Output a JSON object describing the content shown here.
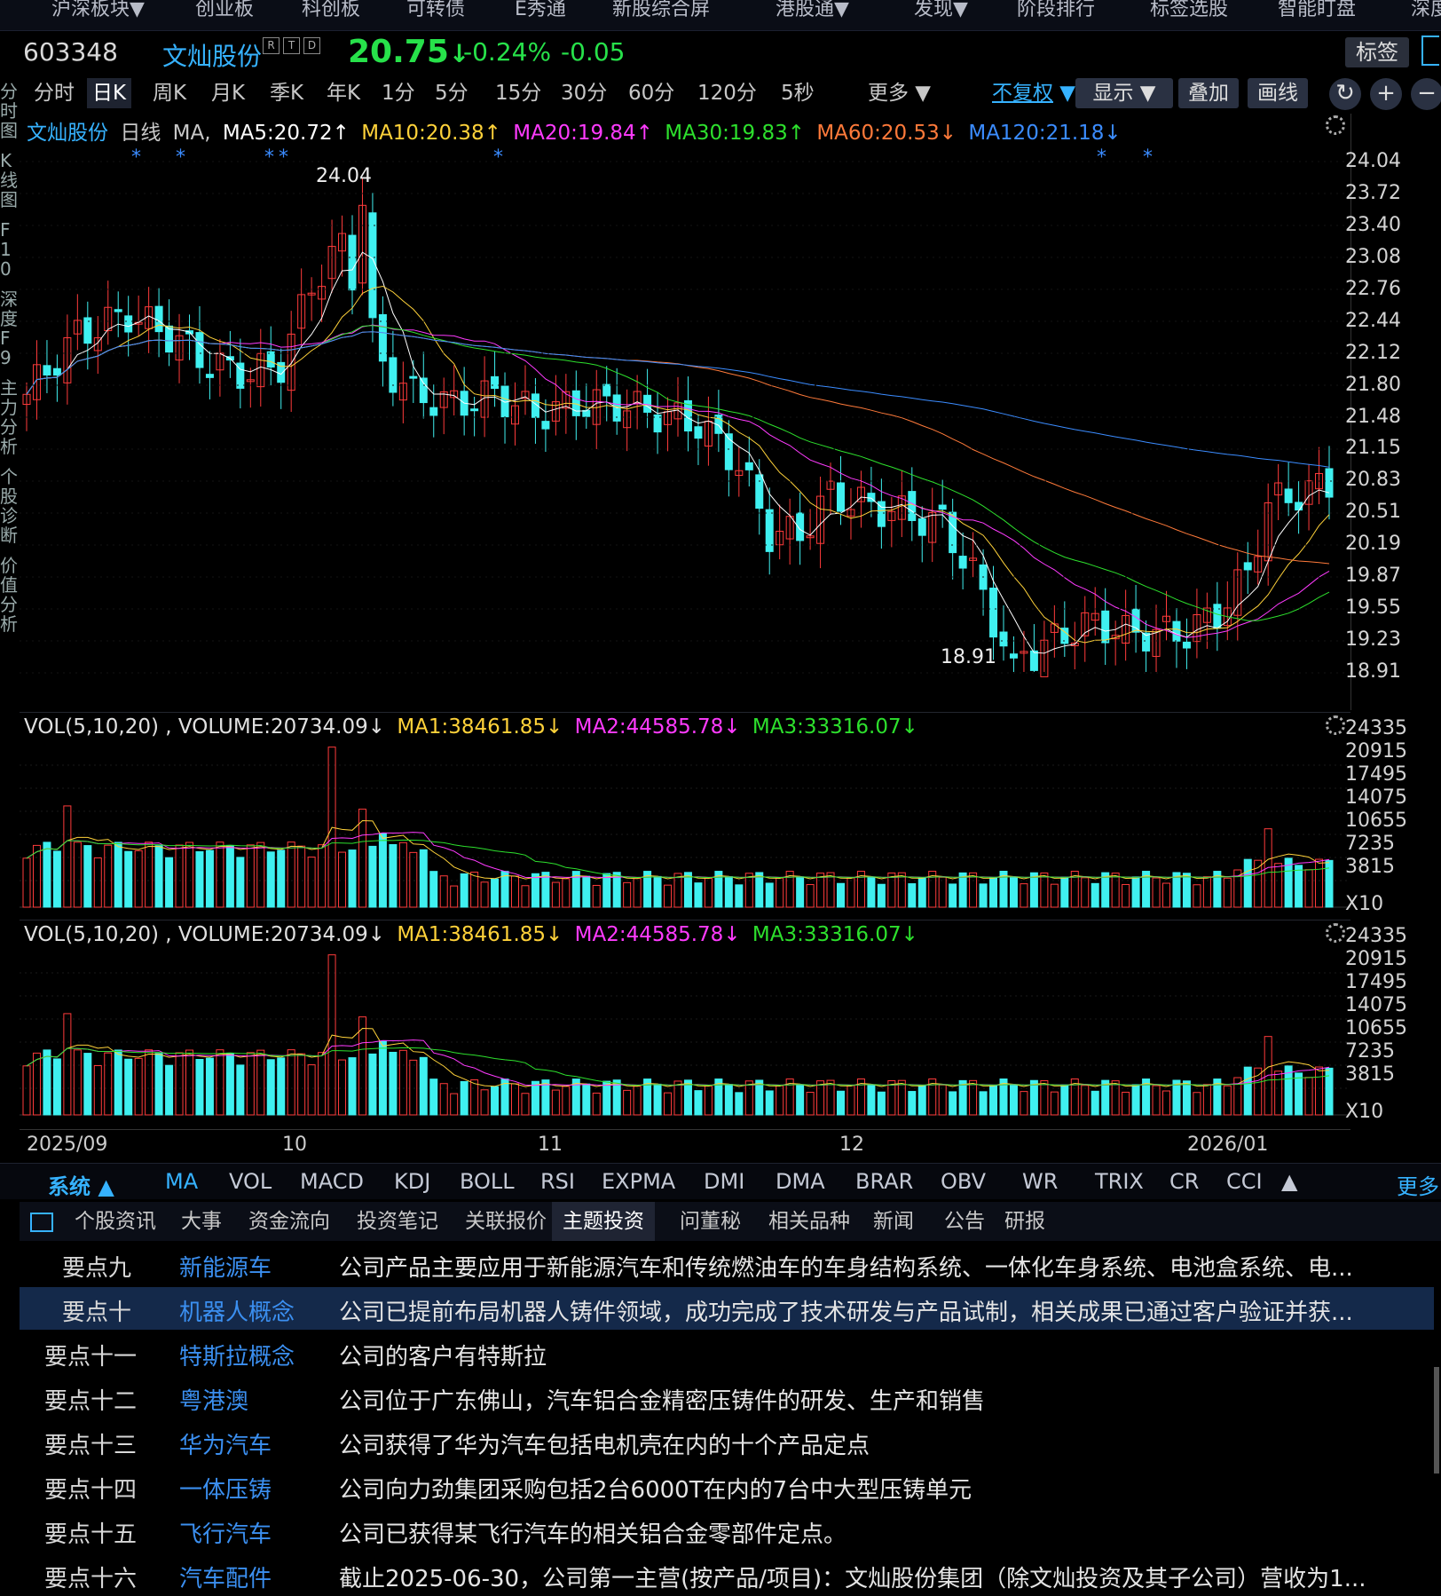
{
  "top_nav": [
    "沪深板块▼",
    "创业板",
    "科创板",
    "可转债",
    "E秀通",
    "新股综合屏",
    "港股通▼",
    "发现▼",
    "阶段排行",
    "标签选股",
    "智能盯盘",
    "深度"
  ],
  "quote": {
    "code": "603348",
    "name": "文灿股份",
    "badges": [
      "R",
      "T",
      "D"
    ],
    "price": "20.75",
    "price_arrow": "↓",
    "change_pct": "-0.24%",
    "change": "-0.05",
    "tag_button": "标签"
  },
  "periods": [
    "分时",
    "日K",
    "周K",
    "月K",
    "季K",
    "年K",
    "1分",
    "5分",
    "15分",
    "30分",
    "60分",
    "120分",
    "5秒",
    "更多 ▼"
  ],
  "active_period": "日K",
  "toolbar": {
    "adjust": "不复权",
    "display": "显示",
    "overlay": "叠加",
    "draw": "画线"
  },
  "left_tabs": [
    "分时图",
    "K线图",
    "F10",
    "深度F9",
    "主力分析",
    "个股诊断",
    "价值分析"
  ],
  "main_legend": {
    "name": "文灿股份",
    "period": "日线",
    "indicator": "MA",
    "ma5": "MA5:20.72↑",
    "ma10": "MA10:20.38↑",
    "ma20": "MA20:19.84↑",
    "ma30": "MA30:19.83↑",
    "ma60": "MA60:20.53↓",
    "ma120": "MA120:21.18↓"
  },
  "price_axis": [
    "24.04",
    "23.72",
    "23.40",
    "23.08",
    "22.76",
    "22.44",
    "22.12",
    "21.80",
    "21.48",
    "21.15",
    "20.83",
    "20.51",
    "20.19",
    "19.87",
    "19.55",
    "19.23",
    "18.91"
  ],
  "annotations": {
    "high": "24.04",
    "low": "18.91"
  },
  "vol_legend": {
    "label": "VOL(5,10,20) , VOLUME:20734.09↓",
    "ma1": "MA1:38461.85↓",
    "ma2": "MA2:44585.78↓",
    "ma3": "MA3:33316.07↓"
  },
  "vol_axis": [
    "24335",
    "20915",
    "17495",
    "14075",
    "10655",
    "7235",
    "3815",
    "X10"
  ],
  "date_axis": [
    "2025/09",
    "10",
    "11",
    "12",
    "2026/01"
  ],
  "indicator_bar": {
    "system": "系统",
    "items": [
      "MA",
      "VOL",
      "MACD",
      "KDJ",
      "BOLL",
      "RSI",
      "EXPMA",
      "DMI",
      "DMA",
      "BRAR",
      "OBV",
      "WR",
      "TRIX",
      "CR",
      "CCI"
    ],
    "more": "更多"
  },
  "info_tabs": [
    "个股资讯",
    "大事",
    "资金流向",
    "投资笔记",
    "关联报价",
    "主题投资",
    "问董秘",
    "相关品种",
    "新闻",
    "公告",
    "研报"
  ],
  "active_info_tab": "主题投资",
  "themes": [
    {
      "point": "要点九",
      "topic": "新能源车",
      "desc": "公司产品主要应用于新能源汽车和传统燃油车的车身结构系统、一体化车身系统、电池盒系统、电..."
    },
    {
      "point": "要点十",
      "topic": "机器人概念",
      "desc": "公司已提前布局机器人铸件领域，成功完成了技术研发与产品试制，相关成果已通过客户验证并获..."
    },
    {
      "point": "要点十一",
      "topic": "特斯拉概念",
      "desc": "公司的客户有特斯拉"
    },
    {
      "point": "要点十二",
      "topic": "粤港澳",
      "desc": "公司位于广东佛山，汽车铝合金精密压铸件的研发、生产和销售"
    },
    {
      "point": "要点十三",
      "topic": "华为汽车",
      "desc": "公司获得了华为汽车包括电机壳在内的十个产品定点"
    },
    {
      "point": "要点十四",
      "topic": "一体压铸",
      "desc": "公司向力劲集团采购包括2台6000T在内的7台中大型压铸单元"
    },
    {
      "point": "要点十五",
      "topic": "飞行汽车",
      "desc": "公司已获得某飞行汽车的相关铝合金零部件定点。"
    },
    {
      "point": "要点十六",
      "topic": "汽车配件",
      "desc": "截止2025-06-30，公司第一主营(按产品/项目)：文灿股份集团（除文灿投资及其子公司）营收为1..."
    }
  ],
  "selected_theme_index": 1,
  "colors": {
    "up": "#ff3b3b",
    "down": "#3ff0f0",
    "ma5": "#ffffff",
    "ma10": "#ffd23a",
    "ma20": "#ff3bff",
    "ma30": "#2de02d",
    "ma60": "#ff7a3a",
    "ma120": "#3b8cff",
    "price_down": "#27e14a",
    "link": "#36b2ff"
  }
}
